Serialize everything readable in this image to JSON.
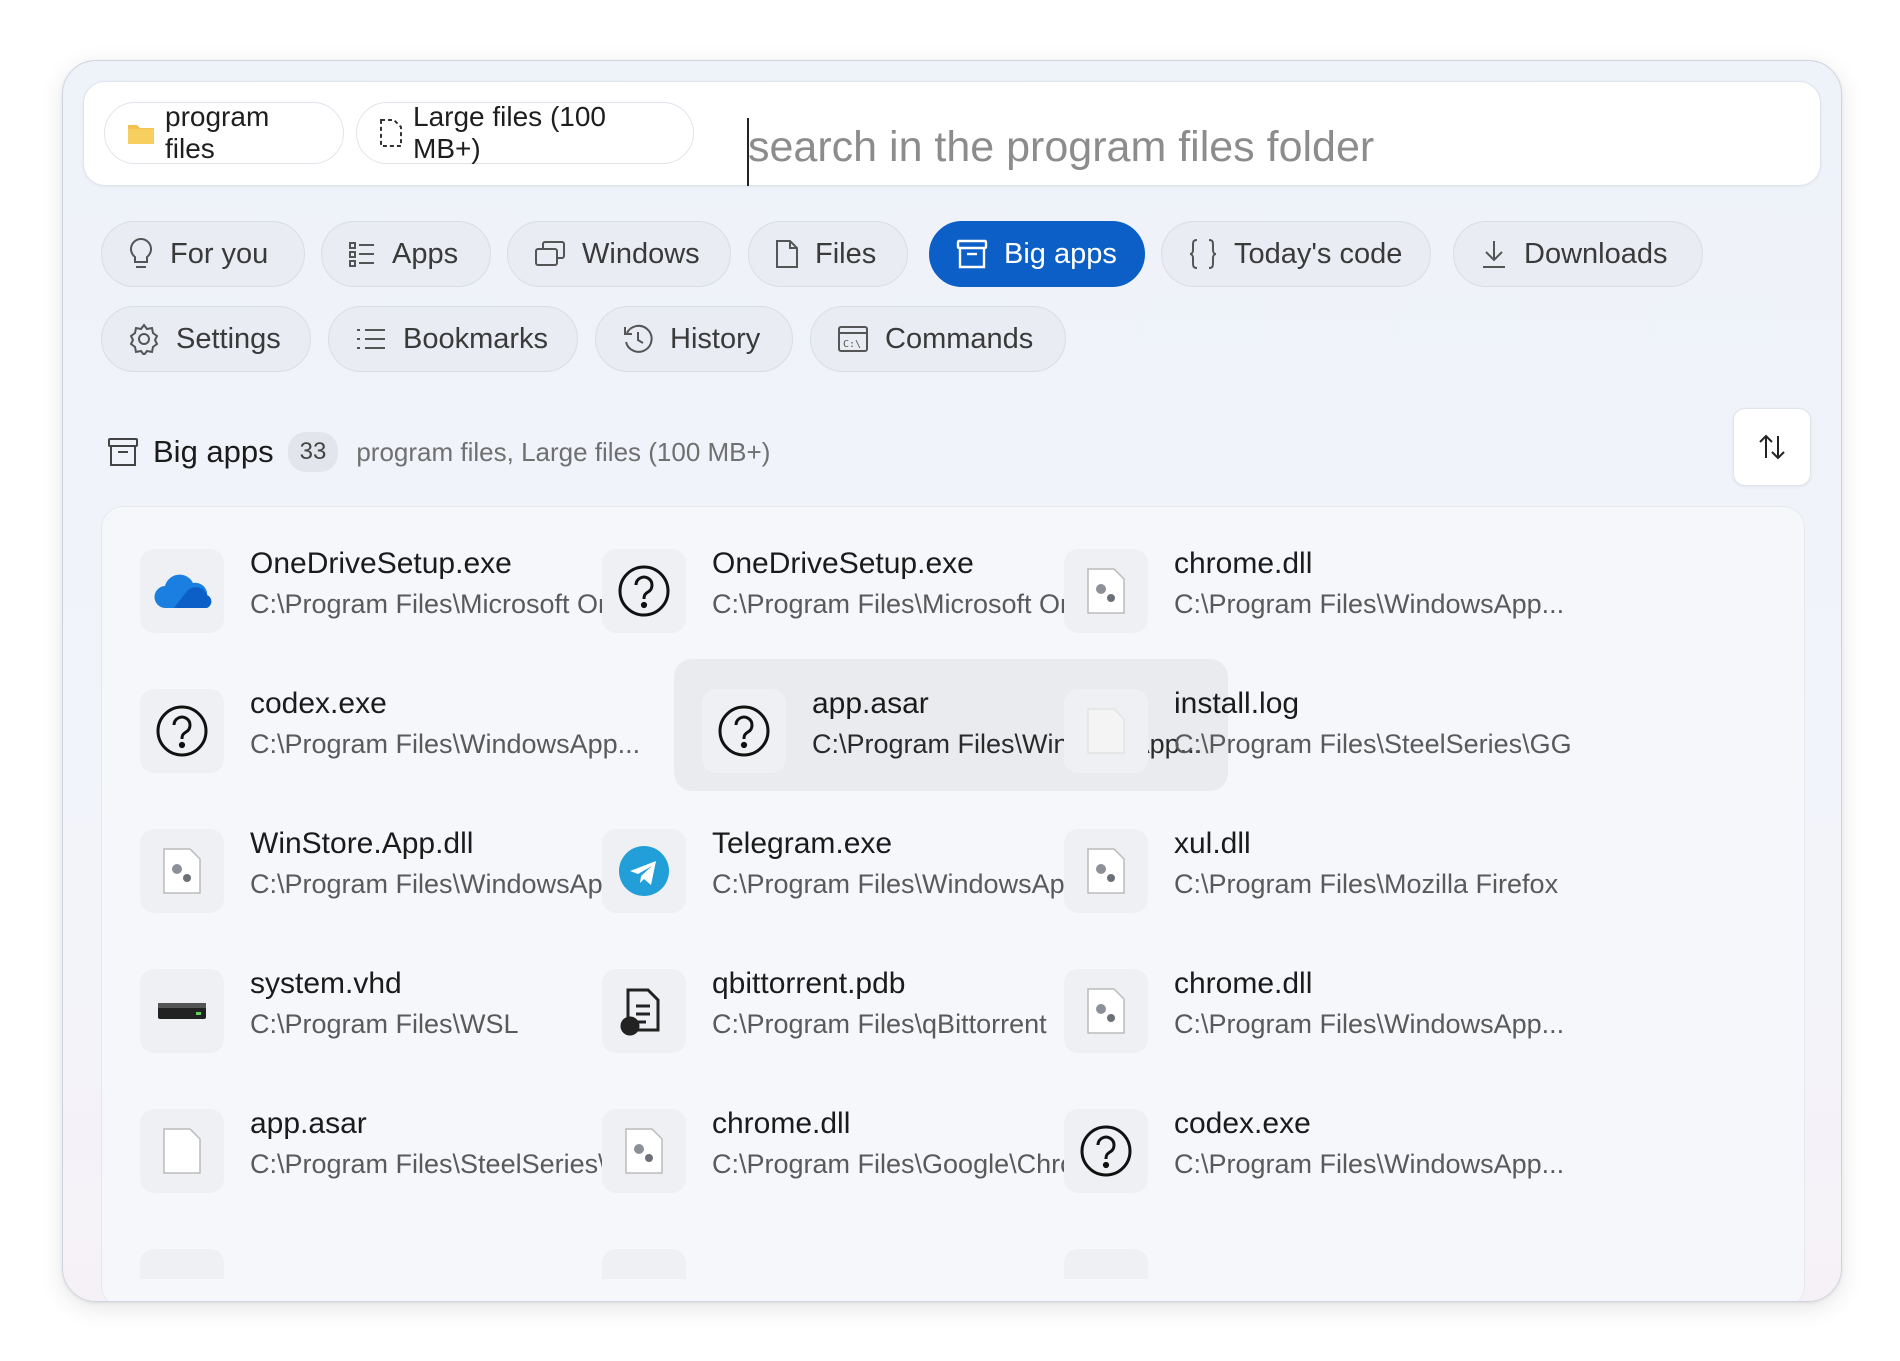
{
  "search": {
    "scope_chip": "program files",
    "filter_chip": "Large files (100 MB+)",
    "placeholder": "search in the program files folder"
  },
  "tabs": [
    {
      "label": "For you",
      "icon": "lightbulb-icon"
    },
    {
      "label": "Apps",
      "icon": "list-icon"
    },
    {
      "label": "Windows",
      "icon": "windows-stack-icon"
    },
    {
      "label": "Files",
      "icon": "file-icon"
    },
    {
      "label": "Big apps",
      "icon": "archive-box-icon",
      "active": true
    },
    {
      "label": "Today's code",
      "icon": "braces-icon"
    },
    {
      "label": "Downloads",
      "icon": "download-icon"
    },
    {
      "label": "Settings",
      "icon": "gear-icon"
    },
    {
      "label": "Bookmarks",
      "icon": "bookmark-list-icon"
    },
    {
      "label": "History",
      "icon": "history-icon"
    },
    {
      "label": "Commands",
      "icon": "terminal-icon"
    }
  ],
  "section": {
    "title": "Big apps",
    "count": "33",
    "filter_summary": "program files, Large files (100 MB+)"
  },
  "results": [
    {
      "name": "OneDriveSetup.exe",
      "path": "C:\\Program Files\\Microsoft On...",
      "icon": "onedrive-cloud-icon"
    },
    {
      "name": "OneDriveSetup.exe",
      "path": "C:\\Program Files\\Microsoft On...",
      "icon": "unknown-file-icon"
    },
    {
      "name": "chrome.dll",
      "path": "C:\\Program Files\\WindowsApp...",
      "icon": "dll-file-icon"
    },
    {
      "name": "codex.exe",
      "path": "C:\\Program Files\\WindowsApp...",
      "icon": "unknown-file-icon"
    },
    {
      "name": "app.asar",
      "path": "C:\\Program Files\\WindowsApp...",
      "icon": "unknown-file-icon"
    },
    {
      "name": "install.log",
      "path": "C:\\Program Files\\SteelSeries\\GG",
      "icon": "blank-file-icon"
    },
    {
      "name": "WinStore.App.dll",
      "path": "C:\\Program Files\\WindowsApp...",
      "icon": "dll-file-icon"
    },
    {
      "name": "Telegram.exe",
      "path": "C:\\Program Files\\WindowsApp...",
      "icon": "telegram-icon"
    },
    {
      "name": "xul.dll",
      "path": "C:\\Program Files\\Mozilla Firefox",
      "icon": "dll-file-icon"
    },
    {
      "name": "system.vhd",
      "path": "C:\\Program Files\\WSL",
      "icon": "drive-icon"
    },
    {
      "name": "qbittorrent.pdb",
      "path": "C:\\Program Files\\qBittorrent",
      "icon": "pdb-file-icon"
    },
    {
      "name": "chrome.dll",
      "path": "C:\\Program Files\\WindowsApp...",
      "icon": "dll-file-icon"
    },
    {
      "name": "app.asar",
      "path": "C:\\Program Files\\SteelSeries\\G...",
      "icon": "blank-file-icon"
    },
    {
      "name": "chrome.dll",
      "path": "C:\\Program Files\\Google\\Chro...",
      "icon": "dll-file-icon"
    },
    {
      "name": "codex.exe",
      "path": "C:\\Program Files\\WindowsApp...",
      "icon": "unknown-file-icon"
    }
  ]
}
